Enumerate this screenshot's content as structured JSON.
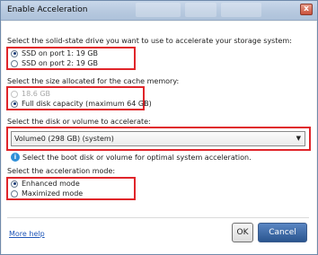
{
  "window": {
    "title": "Enable Acceleration",
    "close_glyph": "x"
  },
  "section_drive": {
    "label": "Select the solid-state drive you want to use to accelerate your storage system:",
    "options": [
      {
        "label": "SSD on port 1: 19 GB",
        "checked": true
      },
      {
        "label": "SSD on port 2: 19 GB",
        "checked": false
      }
    ]
  },
  "section_cache": {
    "label": "Select the size allocated for the cache memory:",
    "options": [
      {
        "label": "18.6 GB",
        "checked": false,
        "disabled": true
      },
      {
        "label": "Full disk capacity (maximum 64 GB)",
        "checked": true,
        "disabled": false
      }
    ]
  },
  "section_volume": {
    "label": "Select the disk or volume to accelerate:",
    "selected": "Volume0 (298 GB) (system)",
    "hint": "Select the boot disk or volume for optimal system acceleration."
  },
  "section_mode": {
    "label": "Select the acceleration mode:",
    "options": [
      {
        "label": "Enhanced mode",
        "checked": true
      },
      {
        "label": "Maximized mode",
        "checked": false
      }
    ]
  },
  "footer": {
    "help_link": "More help",
    "ok": "OK",
    "cancel": "Cancel"
  },
  "colors": {
    "highlight_box": "#e0252a",
    "accent": "#2a558f",
    "link": "#1f56b8"
  }
}
